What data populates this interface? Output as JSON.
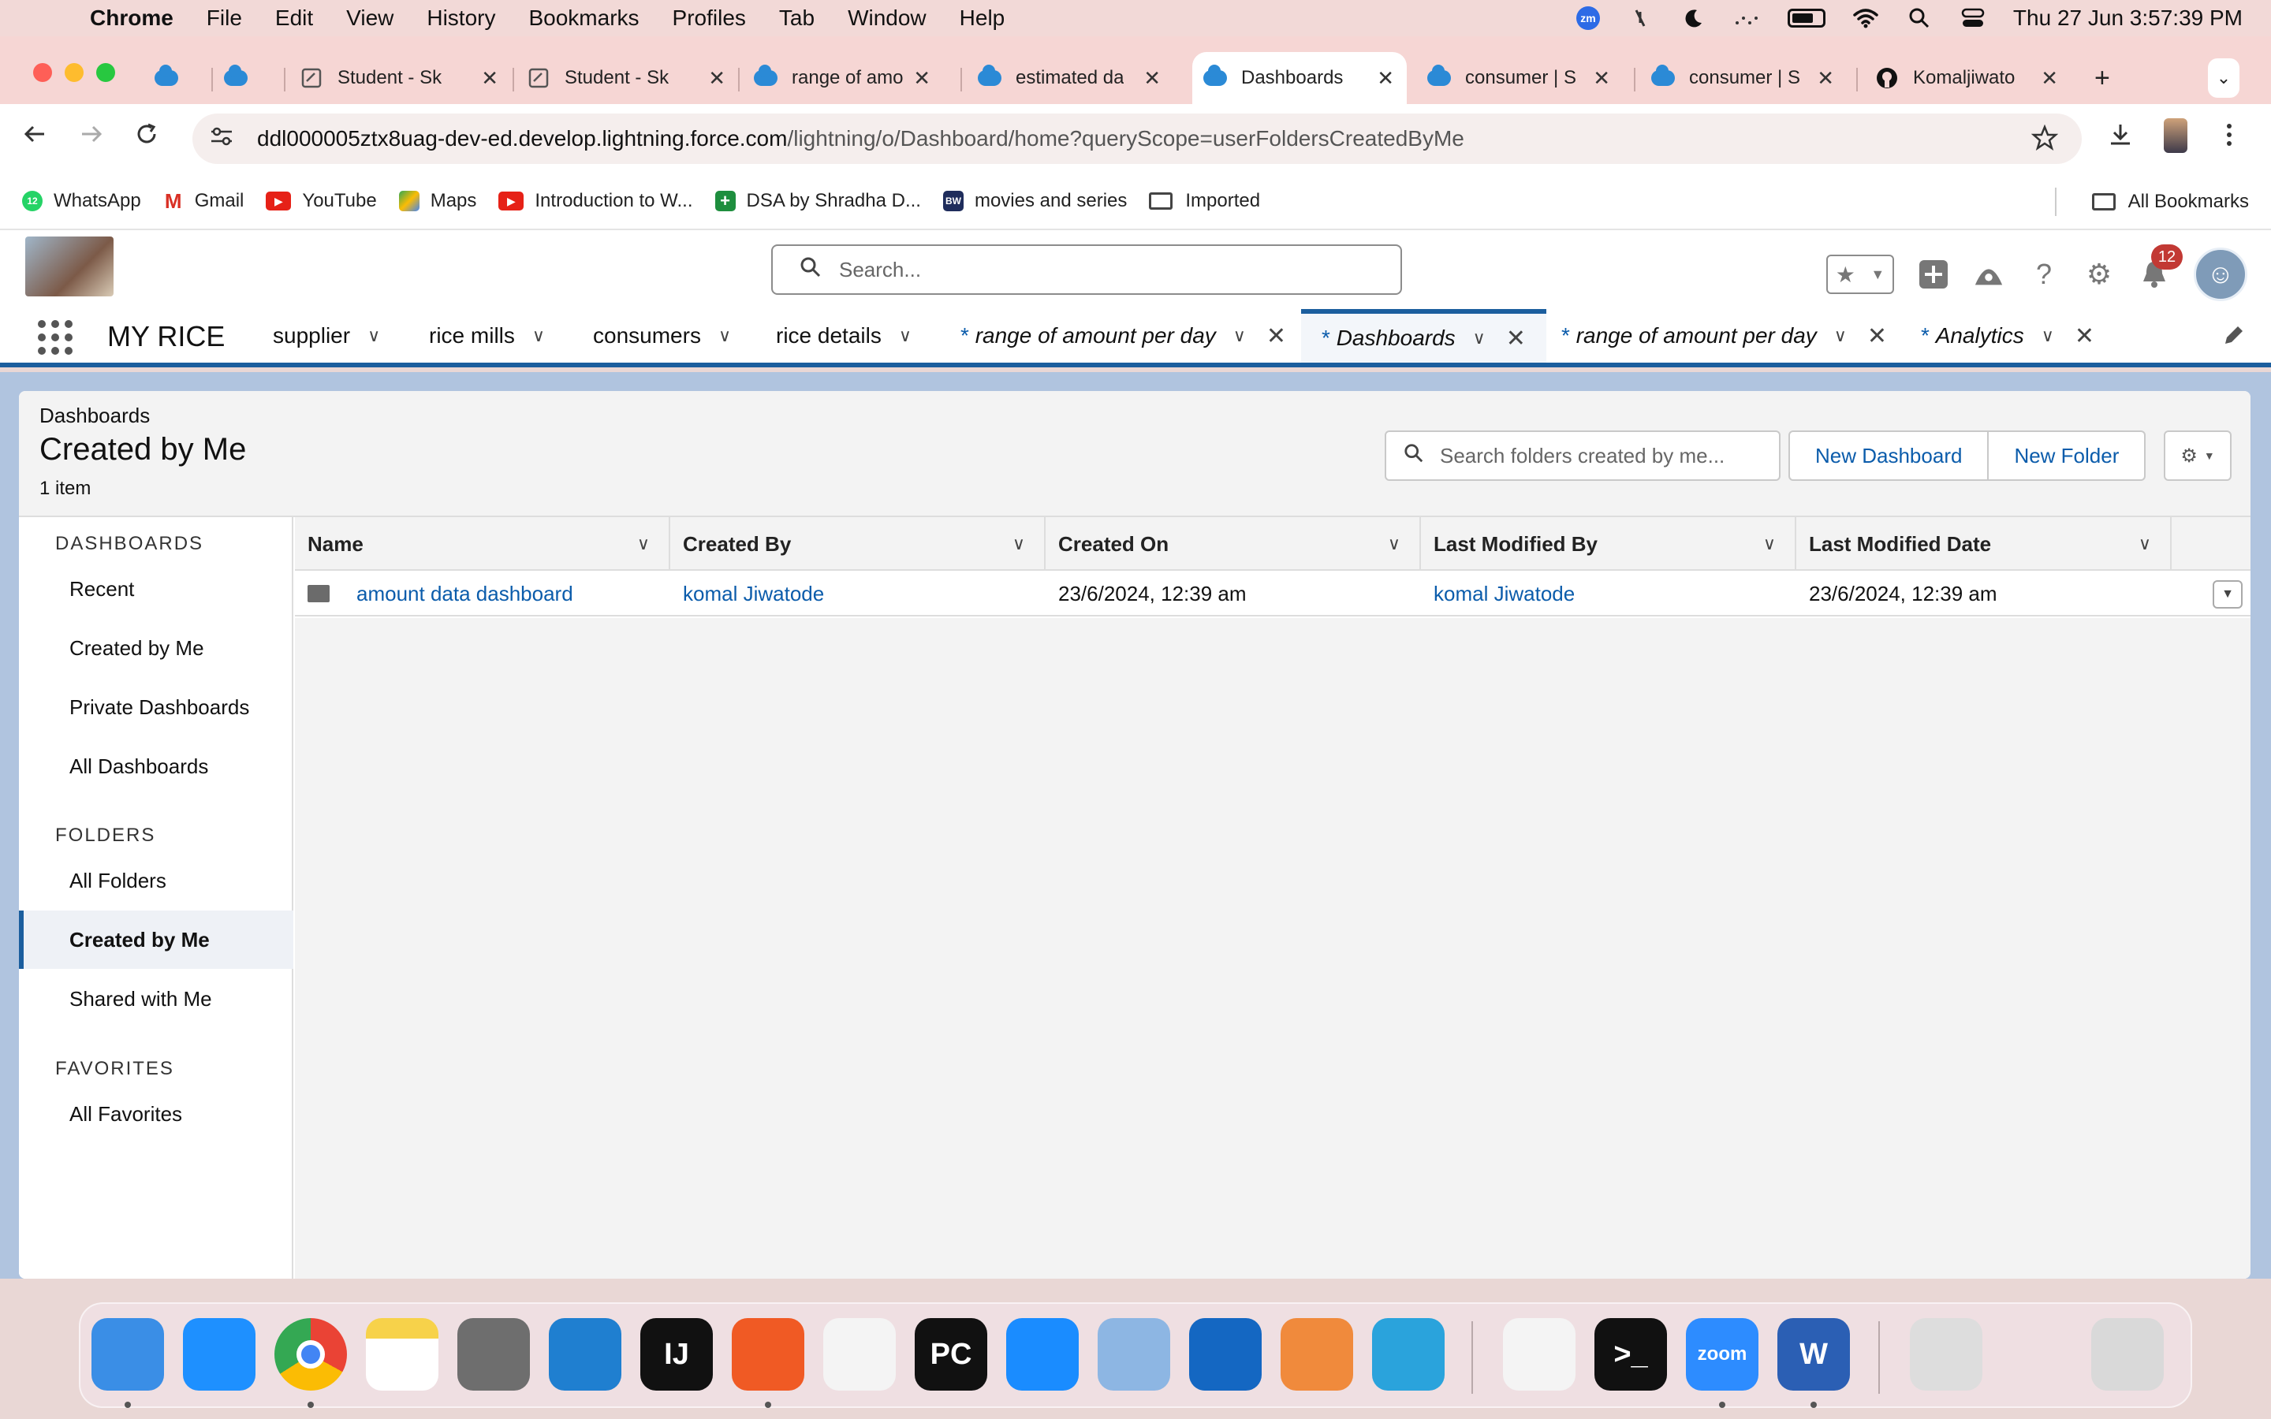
{
  "menubar": {
    "items": [
      "Chrome",
      "File",
      "Edit",
      "View",
      "History",
      "Bookmarks",
      "Profiles",
      "Tab",
      "Window",
      "Help"
    ],
    "zoom_icon_text": "zm",
    "datetime": "Thu 27 Jun  3:57:39 PM"
  },
  "tabs": [
    {
      "label": "",
      "icon": "salesforce-cloud-icon"
    },
    {
      "label": "",
      "icon": "salesforce-cloud-icon"
    },
    {
      "label": "Student - Sk",
      "icon": "document-icon"
    },
    {
      "label": "Student - Sk",
      "icon": "document-icon"
    },
    {
      "label": "range of amo",
      "icon": "salesforce-cloud-icon"
    },
    {
      "label": "estimated da",
      "icon": "salesforce-cloud-icon"
    },
    {
      "label": "Dashboards",
      "icon": "salesforce-cloud-icon",
      "active": true
    },
    {
      "label": "consumer | S",
      "icon": "salesforce-cloud-icon"
    },
    {
      "label": "consumer | S",
      "icon": "salesforce-cloud-icon"
    },
    {
      "label": "Komaljiwato",
      "icon": "github-icon"
    }
  ],
  "address": {
    "host": "ddl000005ztx8uag-dev-ed.develop.lightning.force.com",
    "path": "/lightning/o/Dashboard/home?queryScope=userFoldersCreatedByMe"
  },
  "bookmarks": {
    "items": [
      {
        "label": "WhatsApp",
        "icon": "whatsapp-icon",
        "color": "#25d366",
        "badge": "12"
      },
      {
        "label": "Gmail",
        "icon": "gmail-icon",
        "color": "#d93025"
      },
      {
        "label": "YouTube",
        "icon": "youtube-icon",
        "color": "#e62117"
      },
      {
        "label": "Maps",
        "icon": "maps-icon",
        "color": "#34a853"
      },
      {
        "label": "Introduction to W...",
        "icon": "youtube-icon",
        "color": "#e62117"
      },
      {
        "label": "DSA by Shradha D...",
        "icon": "sheets-icon",
        "color": "#1e8e3e"
      },
      {
        "label": "movies and series",
        "icon": "bw-icon",
        "color": "#1f2d5c",
        "text": "BW"
      },
      {
        "label": "Imported",
        "icon": "folder-icon",
        "color": "#444"
      }
    ],
    "all_bookmarks": "All Bookmarks"
  },
  "sf_header": {
    "search_placeholder": "Search...",
    "notification_count": "12"
  },
  "sf_nav": {
    "app_name": "MY RICE",
    "items": [
      {
        "label": "supplier"
      },
      {
        "label": "rice mills"
      },
      {
        "label": "consumers"
      },
      {
        "label": "rice details"
      },
      {
        "label": "range of amount per day",
        "unsaved": true,
        "closable": true
      },
      {
        "label": "Dashboards",
        "unsaved": true,
        "closable": true,
        "active": true
      },
      {
        "label": "range of amount per day",
        "unsaved": true,
        "closable": true
      },
      {
        "label": "Analytics",
        "unsaved": true,
        "closable": true
      }
    ]
  },
  "list_view": {
    "object_label": "Dashboards",
    "title": "Created by Me",
    "item_count": "1 item",
    "search_placeholder": "Search folders created by me...",
    "new_dashboard": "New Dashboard",
    "new_folder": "New Folder"
  },
  "sidebar": {
    "sections": [
      {
        "heading": "DASHBOARDS",
        "items": [
          "Recent",
          "Created by Me",
          "Private Dashboards",
          "All Dashboards"
        ]
      },
      {
        "heading": "FOLDERS",
        "items": [
          "All Folders",
          "Created by Me",
          "Shared with Me"
        ]
      },
      {
        "heading": "FAVORITES",
        "items": [
          "All Favorites"
        ]
      }
    ],
    "active_item": "FOLDERS/Created by Me"
  },
  "table": {
    "columns": [
      "Name",
      "Created By",
      "Created On",
      "Last Modified By",
      "Last Modified Date"
    ],
    "rows": [
      {
        "name": "amount data dashboard",
        "created_by": "komal Jiwatode",
        "created_on": "23/6/2024, 12:39 am",
        "last_modified_by": "komal Jiwatode",
        "last_modified_date": "23/6/2024, 12:39 am"
      }
    ]
  },
  "dock": {
    "apps": [
      {
        "name": "Finder",
        "icon": "finder-icon",
        "color": "#3a8ee6"
      },
      {
        "name": "Safari",
        "icon": "safari-icon",
        "color": "#1e90ff"
      },
      {
        "name": "Chrome",
        "icon": "chrome-icon",
        "color": "#e8eaed"
      },
      {
        "name": "Notes",
        "icon": "notes-icon",
        "color": "#f7d24a"
      },
      {
        "name": "System Settings",
        "icon": "settings-icon",
        "color": "#6e6e6e"
      },
      {
        "name": "VS Code",
        "icon": "vscode-icon",
        "color": "#1f7fd0"
      },
      {
        "name": "IntelliJ IDEA",
        "icon": "intellij-icon",
        "color": "#111",
        "text": "IJ"
      },
      {
        "name": "Brave",
        "icon": "brave-icon",
        "color": "#f05a24"
      },
      {
        "name": "Instruments",
        "icon": "instruments-icon",
        "color": "#f4f4f4"
      },
      {
        "name": "PyCharm",
        "icon": "pycharm-icon",
        "color": "#111",
        "text": "PC"
      },
      {
        "name": "App Store",
        "icon": "appstore-icon",
        "color": "#1a8cff"
      },
      {
        "name": "Preview",
        "icon": "preview-icon",
        "color": "#8db6e3"
      },
      {
        "name": "Trello",
        "icon": "trello-icon",
        "color": "#1467c2"
      },
      {
        "name": "Pages",
        "icon": "pages-icon",
        "color": "#f08a3c"
      },
      {
        "name": "Telegram",
        "icon": "telegram-icon",
        "color": "#2aa3dc"
      },
      {
        "name": "TextEdit",
        "icon": "textedit-icon",
        "color": "#f4f4f4"
      },
      {
        "name": "Terminal",
        "icon": "terminal-icon",
        "color": "#111",
        "text": ">_"
      },
      {
        "name": "Zoom",
        "icon": "zoom-icon",
        "color": "#2d8cff",
        "text": "zoom"
      },
      {
        "name": "Word",
        "icon": "word-icon",
        "color": "#2b5fb4",
        "text": "W"
      },
      {
        "name": "Recent Windows",
        "icon": "window-stack-icon",
        "color": "#ddd"
      },
      {
        "name": "Trash",
        "icon": "trash-icon",
        "color": "#d9d9d9"
      }
    ]
  }
}
